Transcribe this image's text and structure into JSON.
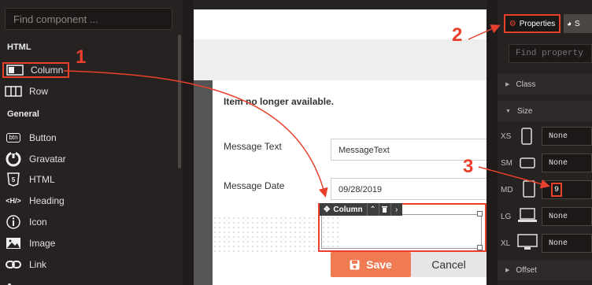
{
  "sidebar": {
    "search_placeholder": "Find component ...",
    "sections": [
      "HTML",
      "General"
    ],
    "html_items": [
      {
        "label": "Column",
        "icon": "column-icon",
        "selected": true
      },
      {
        "label": "Row",
        "icon": "row-icon",
        "selected": false
      }
    ],
    "general_items": [
      {
        "label": "Button",
        "icon": "btn-icon"
      },
      {
        "label": "Gravatar",
        "icon": "gravatar-icon"
      },
      {
        "label": "HTML",
        "icon": "html5-icon"
      },
      {
        "label": "Heading",
        "icon": "heading-icon"
      },
      {
        "label": "Icon",
        "icon": "info-icon"
      },
      {
        "label": "Image",
        "icon": "image-icon"
      },
      {
        "label": "Link",
        "icon": "link-icon"
      }
    ],
    "btn_icon_text": "btn",
    "heading_icon_text": "<H/>"
  },
  "canvas": {
    "notice": "Item no longer available.",
    "message_text_label": "Message Text",
    "message_text_value": "MessageText",
    "message_date_label": "Message Date",
    "message_date_value": "09/28/2019",
    "column_toolbar_label": "Column",
    "save_label": "Save",
    "cancel_label": "Cancel"
  },
  "properties": {
    "tab_label": "Properties",
    "second_tab_label": "S",
    "search_placeholder": "Find property ...",
    "class_label": "Class",
    "size_label": "Size",
    "offset_label": "Offset",
    "sizes": [
      {
        "label": "XS",
        "value": "None"
      },
      {
        "label": "SM",
        "value": "None"
      },
      {
        "label": "MD",
        "value": "9"
      },
      {
        "label": "LG",
        "value": "None"
      },
      {
        "label": "XL",
        "value": "None"
      }
    ]
  },
  "annotations": [
    "1",
    "2",
    "3"
  ],
  "colors": {
    "accent": "#e8402c",
    "save": "#f07a52",
    "panel": "#262221"
  }
}
